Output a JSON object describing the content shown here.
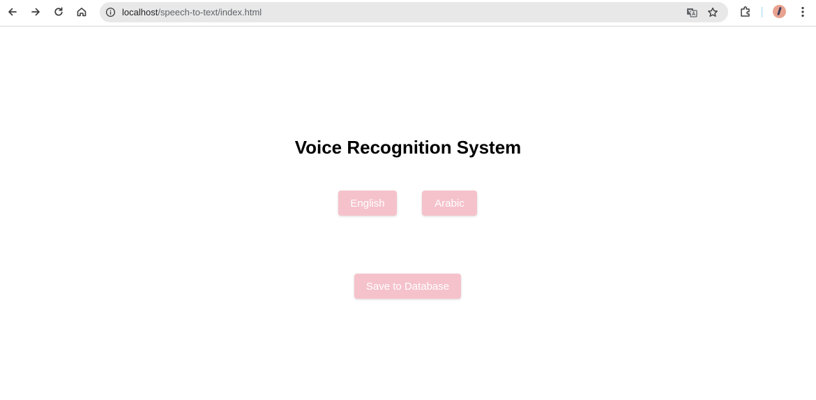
{
  "browser": {
    "url_host": "localhost",
    "url_path": "/speech-to-text/index.html"
  },
  "page": {
    "title": "Voice Recognition System",
    "buttons": {
      "english": "English",
      "arabic": "Arabic",
      "save": "Save to Database"
    }
  },
  "colors": {
    "button_bg": "#f5c2cb",
    "button_text": "#ffffff"
  }
}
